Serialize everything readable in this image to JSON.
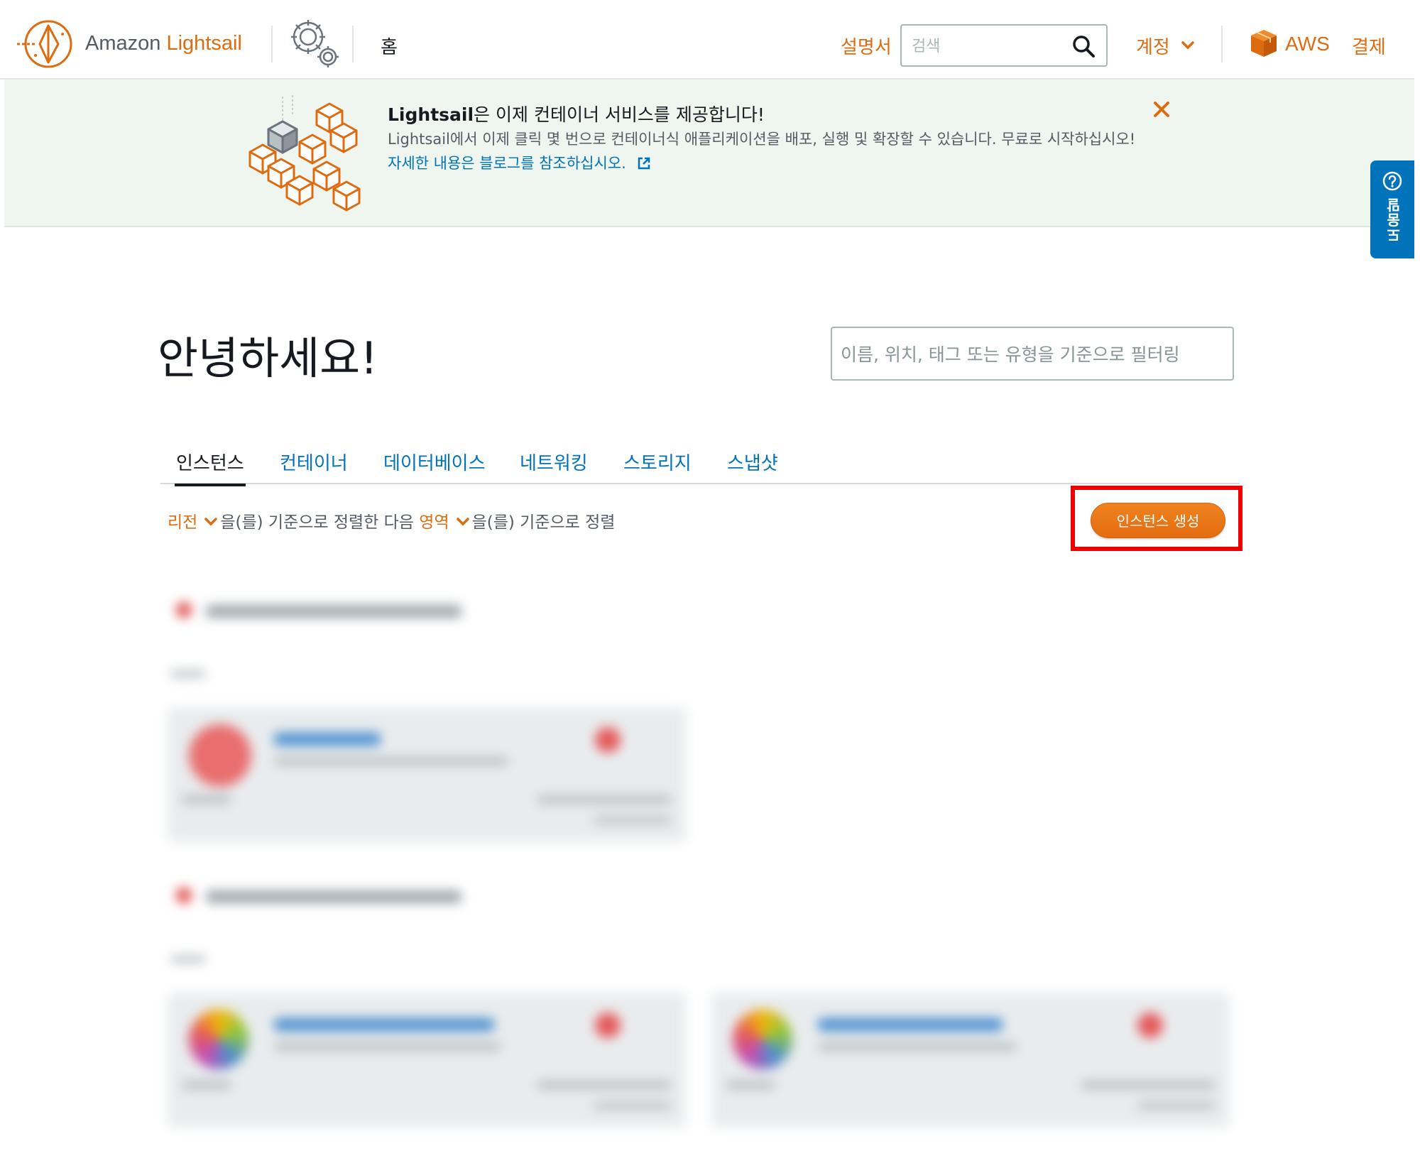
{
  "header": {
    "brand_prefix": "Amazon",
    "brand_accent": "Lightsail",
    "home_label": "홈",
    "docs_label": "설명서",
    "search_placeholder": "검색",
    "account_label": "계정",
    "aws_label": "AWS",
    "billing_label": "결제"
  },
  "banner": {
    "title_bold": "Lightsail",
    "title_rest": "은 이제 컨테이너 서비스를 제공합니다!",
    "description": "Lightsail에서 이제 클릭 몇 번으로 컨테이너식 애플리케이션을 배포, 실행 및 확장할 수 있습니다. 무료로 시작하십시오!",
    "link_text": "자세한 내용은 블로그를 참조하십시오."
  },
  "help_tab": {
    "label": "도움말"
  },
  "main": {
    "greeting": "안녕하세요!",
    "filter_placeholder": "이름, 위치, 태그 또는 유형을 기준으로 필터링",
    "tabs": [
      {
        "label": "인스턴스",
        "active": true
      },
      {
        "label": "컨테이너",
        "active": false
      },
      {
        "label": "데이터베이스",
        "active": false
      },
      {
        "label": "네트워킹",
        "active": false
      },
      {
        "label": "스토리지",
        "active": false
      },
      {
        "label": "스냅샷",
        "active": false
      }
    ],
    "sort": {
      "first_option": "리전",
      "middle_text": "을(를) 기준으로 정렬한 다음",
      "second_option": "영역",
      "end_text": "을(를) 기준으로 정렬"
    },
    "create_button": "인스턴스 생성"
  },
  "colors": {
    "accent": "#dd6b10",
    "link": "#0073bb",
    "banner_bg": "#eff6ef",
    "highlight": "#ee0000"
  }
}
